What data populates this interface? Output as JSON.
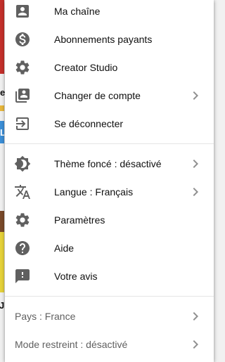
{
  "menu": {
    "account_items": [
      {
        "label": "Ma chaîne",
        "icon": "account-box-icon"
      },
      {
        "label": "Abonnements payants",
        "icon": "dollar-circle-icon"
      },
      {
        "label": "Creator Studio",
        "icon": "gear-icon"
      },
      {
        "label": "Changer de compte",
        "icon": "switch-account-icon"
      },
      {
        "label": "Se déconnecter",
        "icon": "sign-out-icon"
      }
    ],
    "settings_items": [
      {
        "label": "Thème foncé : désactivé",
        "icon": "brightness-icon"
      },
      {
        "label": "Langue : Français",
        "icon": "translate-icon"
      },
      {
        "label": "Paramètres",
        "icon": "gear-icon"
      },
      {
        "label": "Aide",
        "icon": "help-icon"
      },
      {
        "label": "Votre avis",
        "icon": "feedback-icon"
      }
    ],
    "footer_items": [
      {
        "label": "Pays : France"
      },
      {
        "label": "Mode restreint : désactivé"
      }
    ]
  },
  "background": {
    "edge_chars": [
      "e",
      "L",
      "JR"
    ]
  },
  "colors": {
    "icon": "#606060",
    "text": "#0f0f0f",
    "secondary_text": "#606060",
    "divider": "#e5e5e5",
    "menu_bg": "#ffffff"
  }
}
